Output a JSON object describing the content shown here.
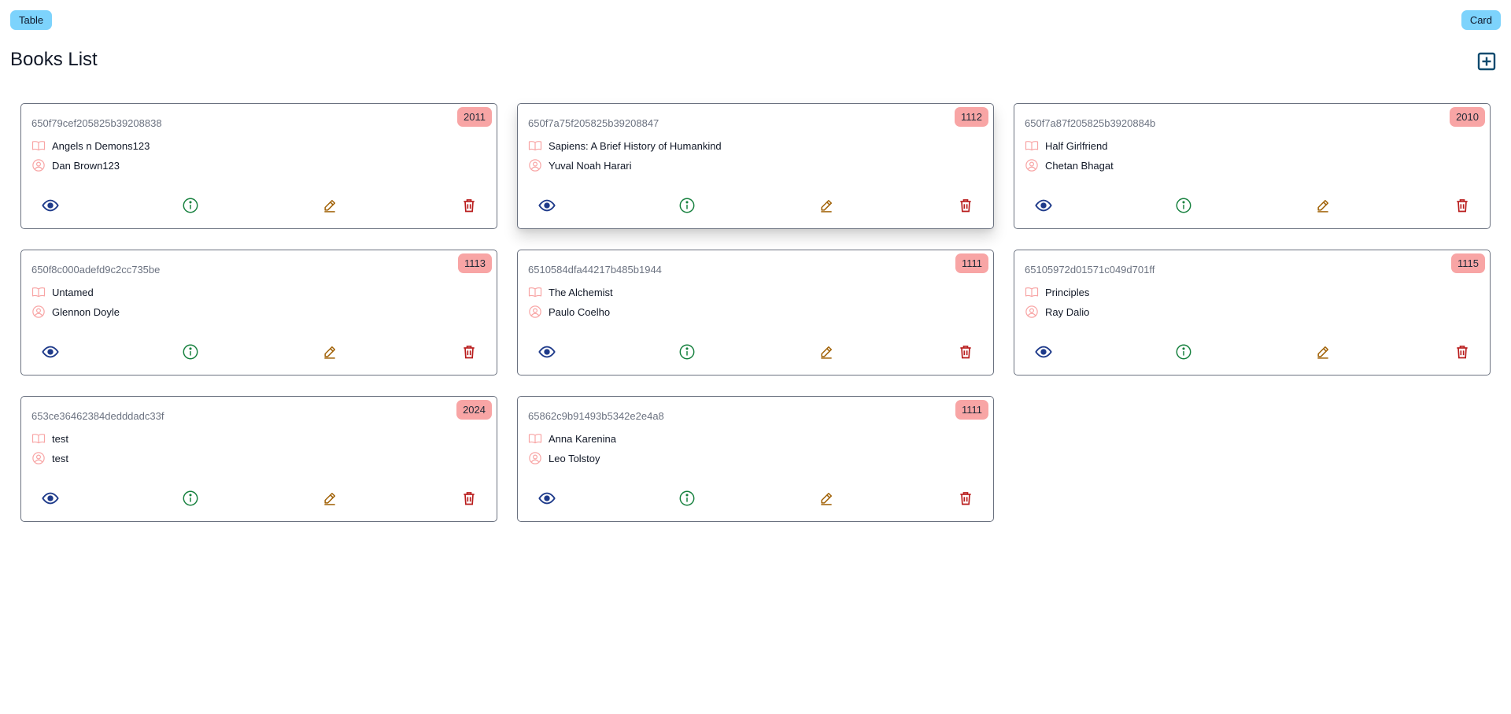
{
  "toolbar": {
    "table_label": "Table",
    "card_label": "Card"
  },
  "header": {
    "title": "Books List",
    "add_icon": "plus-square-icon"
  },
  "colors": {
    "toggle_button": "#7dd3fc",
    "year_badge": "#f8a5a5",
    "view_icon": "#1e3a8a",
    "info_icon": "#15803d",
    "edit_icon": "#a16207",
    "delete_icon": "#b91c1c",
    "row_icon": "#f8a5a5",
    "add_icon": "#0c4a6e"
  },
  "books": [
    {
      "id": "650f79cef205825b39208838",
      "title": "Angels n Demons123",
      "author": "Dan Brown123",
      "year": "2011"
    },
    {
      "id": "650f7a75f205825b39208847",
      "title": "Sapiens: A Brief History of Humankind",
      "author": "Yuval Noah Harari",
      "year": "1112"
    },
    {
      "id": "650f7a87f205825b3920884b",
      "title": "Half Girlfriend",
      "author": "Chetan Bhagat",
      "year": "2010"
    },
    {
      "id": "650f8c000adefd9c2cc735be",
      "title": "Untamed",
      "author": "Glennon Doyle",
      "year": "1113"
    },
    {
      "id": "6510584dfa44217b485b1944",
      "title": "The Alchemist",
      "author": "Paulo Coelho",
      "year": "1111"
    },
    {
      "id": "65105972d01571c049d701ff",
      "title": "Principles",
      "author": "Ray Dalio",
      "year": "1115"
    },
    {
      "id": "653ce36462384dedddadc33f",
      "title": "test",
      "author": "test",
      "year": "2024"
    },
    {
      "id": "65862c9b91493b5342e2e4a8",
      "title": "Anna Karenina",
      "author": "Leo Tolstoy",
      "year": "1111"
    }
  ],
  "card_icons": {
    "title_icon": "book-open-icon",
    "author_icon": "user-circle-icon",
    "view_icon": "eye-icon",
    "info_icon": "info-circle-icon",
    "edit_icon": "pencil-icon",
    "delete_icon": "trash-icon"
  }
}
